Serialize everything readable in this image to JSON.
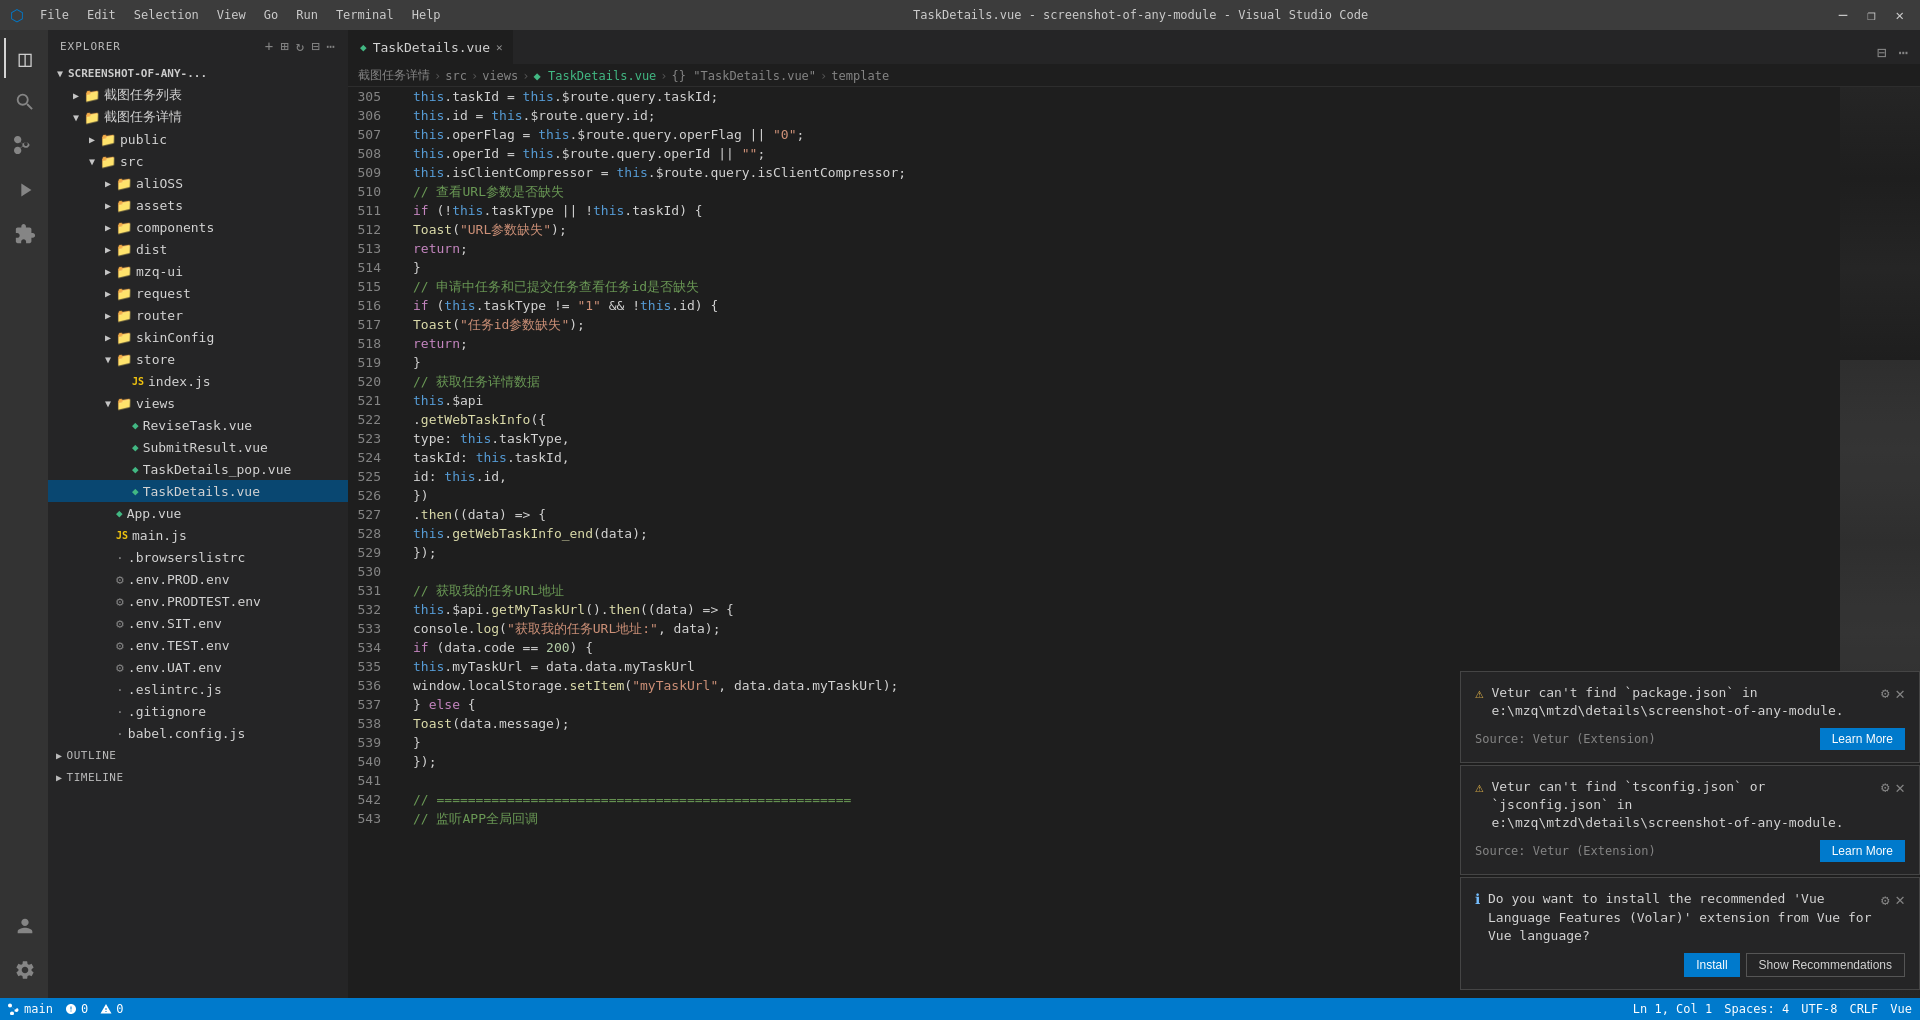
{
  "titlebar": {
    "icon": "⬡",
    "menu": [
      "File",
      "Edit",
      "Selection",
      "View",
      "Go",
      "Run",
      "Terminal",
      "Help"
    ],
    "title": "TaskDetails.vue - screenshot-of-any-module - Visual Studio Code",
    "buttons": [
      "⊟",
      "❐",
      "✕"
    ]
  },
  "activity_bar": {
    "icons": [
      {
        "name": "explorer-icon",
        "symbol": "⧉",
        "active": true
      },
      {
        "name": "search-icon",
        "symbol": "🔍",
        "active": false
      },
      {
        "name": "source-control-icon",
        "symbol": "⑂",
        "active": false
      },
      {
        "name": "run-icon",
        "symbol": "▶",
        "active": false
      },
      {
        "name": "extensions-icon",
        "symbol": "⊞",
        "active": false
      }
    ],
    "bottom_icons": [
      {
        "name": "account-icon",
        "symbol": "👤"
      },
      {
        "name": "settings-icon",
        "symbol": "⚙"
      }
    ]
  },
  "sidebar": {
    "header": "Explorer",
    "root": "SCREENSHOT-OF-ANY-...",
    "tree": [
      {
        "indent": 0,
        "arrow": "▼",
        "icon": "",
        "label": "SCREENSHOT-OF-ANY-...",
        "type": "folder-root"
      },
      {
        "indent": 1,
        "arrow": "▶",
        "icon": "📁",
        "label": "截图任务列表",
        "type": "folder"
      },
      {
        "indent": 1,
        "arrow": "▼",
        "icon": "📁",
        "label": "截图任务详情",
        "type": "folder"
      },
      {
        "indent": 2,
        "arrow": "▶",
        "icon": "📁",
        "label": "public",
        "type": "folder"
      },
      {
        "indent": 2,
        "arrow": "▶",
        "icon": "📁",
        "label": "src",
        "type": "folder"
      },
      {
        "indent": 3,
        "arrow": "▶",
        "icon": "📁",
        "label": "aliOSS",
        "type": "folder"
      },
      {
        "indent": 3,
        "arrow": "▶",
        "icon": "📁",
        "label": "assets",
        "type": "folder"
      },
      {
        "indent": 3,
        "arrow": "▶",
        "icon": "📁",
        "label": "components",
        "type": "folder"
      },
      {
        "indent": 3,
        "arrow": "▶",
        "icon": "📁",
        "label": "dist",
        "type": "folder"
      },
      {
        "indent": 3,
        "arrow": "▶",
        "icon": "📁",
        "label": "mzq-ui",
        "type": "folder"
      },
      {
        "indent": 3,
        "arrow": "▶",
        "icon": "📁",
        "label": "request",
        "type": "folder"
      },
      {
        "indent": 3,
        "arrow": "▶",
        "icon": "📁",
        "label": "router",
        "type": "folder"
      },
      {
        "indent": 3,
        "arrow": "▶",
        "icon": "📁",
        "label": "skinConfig",
        "type": "folder"
      },
      {
        "indent": 3,
        "arrow": "▼",
        "icon": "📁",
        "label": "store",
        "type": "folder"
      },
      {
        "indent": 4,
        "arrow": "",
        "icon": "JS",
        "label": "index.js",
        "type": "js"
      },
      {
        "indent": 3,
        "arrow": "▼",
        "icon": "📁",
        "label": "views",
        "type": "folder"
      },
      {
        "indent": 4,
        "arrow": "",
        "icon": "V",
        "label": "ReviseTask.vue",
        "type": "vue"
      },
      {
        "indent": 4,
        "arrow": "",
        "icon": "V",
        "label": "SubmitResult.vue",
        "type": "vue"
      },
      {
        "indent": 4,
        "arrow": "",
        "icon": "V",
        "label": "TaskDetails_pop.vue",
        "type": "vue"
      },
      {
        "indent": 4,
        "arrow": "",
        "icon": "V",
        "label": "TaskDetails.vue",
        "type": "vue",
        "selected": true
      },
      {
        "indent": 3,
        "arrow": "",
        "icon": "V",
        "label": "App.vue",
        "type": "vue"
      },
      {
        "indent": 3,
        "arrow": "",
        "icon": "JS",
        "label": "main.js",
        "type": "js"
      },
      {
        "indent": 3,
        "arrow": "",
        "icon": ".",
        "label": ".browserslistrc",
        "type": "config"
      },
      {
        "indent": 3,
        "arrow": "",
        "icon": "⚙",
        "label": ".env.PROD.env",
        "type": "config"
      },
      {
        "indent": 3,
        "arrow": "",
        "icon": "⚙",
        "label": ".env.PRODTEST.env",
        "type": "config"
      },
      {
        "indent": 3,
        "arrow": "",
        "icon": "⚙",
        "label": ".env.SIT.env",
        "type": "config"
      },
      {
        "indent": 3,
        "arrow": "",
        "icon": "⚙",
        "label": ".env.TEST.env",
        "type": "config"
      },
      {
        "indent": 3,
        "arrow": "",
        "icon": "⚙",
        "label": ".env.UAT.env",
        "type": "config"
      },
      {
        "indent": 3,
        "arrow": "",
        "icon": ".",
        "label": ".eslintrc.js",
        "type": "config"
      },
      {
        "indent": 3,
        "arrow": "",
        "icon": ".",
        "label": ".gitignore",
        "type": "config"
      },
      {
        "indent": 3,
        "arrow": "",
        "icon": ".",
        "label": "babel.config.js",
        "type": "config"
      }
    ],
    "sections": [
      {
        "label": "OUTLINE",
        "expanded": false
      },
      {
        "label": "TIMELINE",
        "expanded": false
      }
    ]
  },
  "editor": {
    "tab": {
      "label": "TaskDetails.vue",
      "icon": "◆",
      "active": true
    },
    "breadcrumb": {
      "parts": [
        "截图任务详情",
        "src",
        "views",
        "TaskDetails.vue",
        "{} \"TaskDetails.vue\"",
        "template"
      ]
    },
    "lines": [
      {
        "num": 305,
        "content": "            this.taskId = this.$route.query.taskId;"
      },
      {
        "num": 306,
        "content": "            this.id = this.$route.query.id;"
      },
      {
        "num": 507,
        "content": "            this.operFlag = this.$route.query.operFlag || \"0\";"
      },
      {
        "num": 508,
        "content": "            this.operId = this.$route.query.operId || \"\";"
      },
      {
        "num": 509,
        "content": "            this.isClientCompressor = this.$route.query.isClientCompressor;"
      },
      {
        "num": 510,
        "content": "            // 查看URL参数是否缺失",
        "comment": true
      },
      {
        "num": 511,
        "content": "            if (!this.taskType || !this.taskId) {"
      },
      {
        "num": 512,
        "content": "                Toast(\"URL参数缺失\");"
      },
      {
        "num": 513,
        "content": "                return;"
      },
      {
        "num": 514,
        "content": "            }"
      },
      {
        "num": 515,
        "content": "            // 申请中任务和已提交任务查看任务id是否缺失",
        "comment": true
      },
      {
        "num": 516,
        "content": "            if (this.taskType != \"1\" && !this.id) {"
      },
      {
        "num": 517,
        "content": "                Toast(\"任务id参数缺失\");"
      },
      {
        "num": 518,
        "content": "                return;"
      },
      {
        "num": 519,
        "content": "            }"
      },
      {
        "num": 520,
        "content": "            // 获取任务详情数据",
        "comment": true
      },
      {
        "num": 521,
        "content": "            this.$api"
      },
      {
        "num": 522,
        "content": "                .getWebTaskInfo({"
      },
      {
        "num": 523,
        "content": "                    type: this.taskType,"
      },
      {
        "num": 524,
        "content": "                    taskId: this.taskId,"
      },
      {
        "num": 525,
        "content": "                    id: this.id,"
      },
      {
        "num": 526,
        "content": "                })"
      },
      {
        "num": 527,
        "content": "                .then((data) => {"
      },
      {
        "num": 528,
        "content": "                    this.getWebTaskInfo_end(data);"
      },
      {
        "num": 529,
        "content": "                });"
      },
      {
        "num": 530,
        "content": ""
      },
      {
        "num": 531,
        "content": "            // 获取我的任务URL地址",
        "comment": true
      },
      {
        "num": 532,
        "content": "            this.$api.getMyTaskUrl().then((data) => {"
      },
      {
        "num": 533,
        "content": "                console.log(\"获取我的任务URL地址:\", data);"
      },
      {
        "num": 534,
        "content": "                if (data.code == 200) {"
      },
      {
        "num": 535,
        "content": "                    this.myTaskUrl = data.data.myTaskUrl"
      },
      {
        "num": 536,
        "content": "                    window.localStorage.setItem(\"myTaskUrl\", data.data.myTaskUrl);"
      },
      {
        "num": 537,
        "content": "                } else {"
      },
      {
        "num": 538,
        "content": "                    Toast(data.message);"
      },
      {
        "num": 539,
        "content": "                }"
      },
      {
        "num": 540,
        "content": "            });"
      },
      {
        "num": 541,
        "content": ""
      },
      {
        "num": 542,
        "content": "            // ====================================================="
      },
      {
        "num": 543,
        "content": "            // 监听APP全局回调"
      }
    ]
  },
  "notifications": [
    {
      "id": "notif-1",
      "type": "warning",
      "icon": "⚠",
      "message": "Vetur can't find `package.json` in e:\\mzq\\mtzd\\details\\screenshot-of-any-module.",
      "source": "Source: Vetur (Extension)",
      "buttons": [
        "Learn More"
      ],
      "has_gear": true,
      "has_close": true
    },
    {
      "id": "notif-2",
      "type": "warning",
      "icon": "⚠",
      "message": "Vetur can't find `tsconfig.json` or `jsconfig.json` in e:\\mzq\\mtzd\\details\\screenshot-of-any-module.",
      "source": "Source: Vetur (Extension)",
      "buttons": [
        "Learn More"
      ],
      "has_gear": true,
      "has_close": true
    },
    {
      "id": "notif-3",
      "type": "info",
      "icon": "ℹ",
      "message": "Do you want to install the recommended 'Vue Language Features (Volar)' extension from Vue for Vue language?",
      "source": "",
      "buttons": [
        "Install",
        "Show Recommendations"
      ],
      "has_gear": true,
      "has_close": true
    }
  ],
  "status_bar": {
    "left": [
      {
        "text": "⎇ main",
        "name": "git-branch"
      },
      {
        "text": "⚠ 0",
        "name": "errors"
      },
      {
        "text": "⚠ 0",
        "name": "warnings"
      }
    ],
    "right": [
      {
        "text": "Ln 1, Col 1",
        "name": "cursor-position"
      },
      {
        "text": "Spaces: 4",
        "name": "spaces"
      },
      {
        "text": "UTF-8",
        "name": "encoding"
      },
      {
        "text": "CRLF",
        "name": "line-ending"
      },
      {
        "text": "Vue",
        "name": "language-mode"
      }
    ]
  }
}
